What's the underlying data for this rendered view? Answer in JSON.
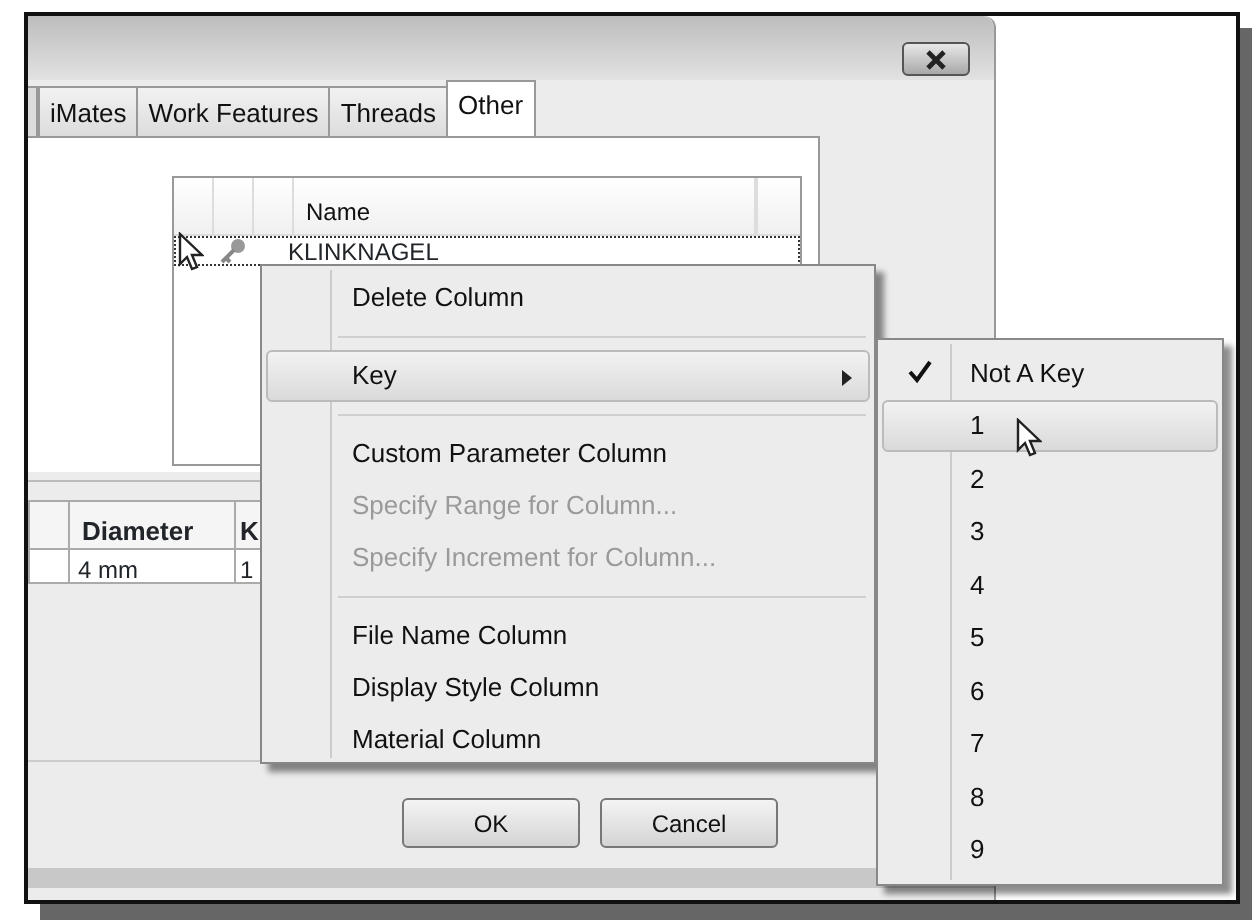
{
  "dialog": {
    "tabs": [
      {
        "label": "iMates",
        "selected": false
      },
      {
        "label": "Work Features",
        "selected": false
      },
      {
        "label": "Threads",
        "selected": false
      },
      {
        "label": "Other",
        "selected": true
      }
    ],
    "grid": {
      "columns": [
        "Name"
      ],
      "rows": [
        {
          "name": "KLINKNAGEL",
          "selected": true
        }
      ]
    },
    "table": {
      "columns": [
        "Diameter",
        "K"
      ],
      "rows": [
        [
          "4 mm",
          "1"
        ]
      ]
    },
    "buttons": [
      "OK",
      "Cancel"
    ]
  },
  "context_menu": {
    "items": [
      {
        "kind": "item",
        "label": "Delete Column",
        "disabled": false,
        "highlighted": false,
        "submenu": false
      },
      {
        "kind": "separator"
      },
      {
        "kind": "item",
        "label": "Key",
        "disabled": false,
        "highlighted": true,
        "submenu": true
      },
      {
        "kind": "separator"
      },
      {
        "kind": "item",
        "label": "Custom Parameter Column",
        "disabled": false,
        "highlighted": false,
        "submenu": false
      },
      {
        "kind": "item",
        "label": "Specify Range for Column...",
        "disabled": true,
        "highlighted": false,
        "submenu": false
      },
      {
        "kind": "item",
        "label": "Specify Increment for Column...",
        "disabled": true,
        "highlighted": false,
        "submenu": false
      },
      {
        "kind": "separator"
      },
      {
        "kind": "item",
        "label": "File Name Column",
        "disabled": false,
        "highlighted": false,
        "submenu": false
      },
      {
        "kind": "item",
        "label": "Display Style Column",
        "disabled": false,
        "highlighted": false,
        "submenu": false
      },
      {
        "kind": "item",
        "label": "Material Column",
        "disabled": false,
        "highlighted": false,
        "submenu": false
      }
    ]
  },
  "submenu": {
    "items": [
      {
        "label": "Not A Key",
        "checked": true,
        "highlighted": false
      },
      {
        "label": "1",
        "checked": false,
        "highlighted": true
      },
      {
        "label": "2",
        "checked": false,
        "highlighted": false
      },
      {
        "label": "3",
        "checked": false,
        "highlighted": false
      },
      {
        "label": "4",
        "checked": false,
        "highlighted": false
      },
      {
        "label": "5",
        "checked": false,
        "highlighted": false
      },
      {
        "label": "6",
        "checked": false,
        "highlighted": false
      },
      {
        "label": "7",
        "checked": false,
        "highlighted": false
      },
      {
        "label": "8",
        "checked": false,
        "highlighted": false
      },
      {
        "label": "9",
        "checked": false,
        "highlighted": false
      }
    ]
  }
}
